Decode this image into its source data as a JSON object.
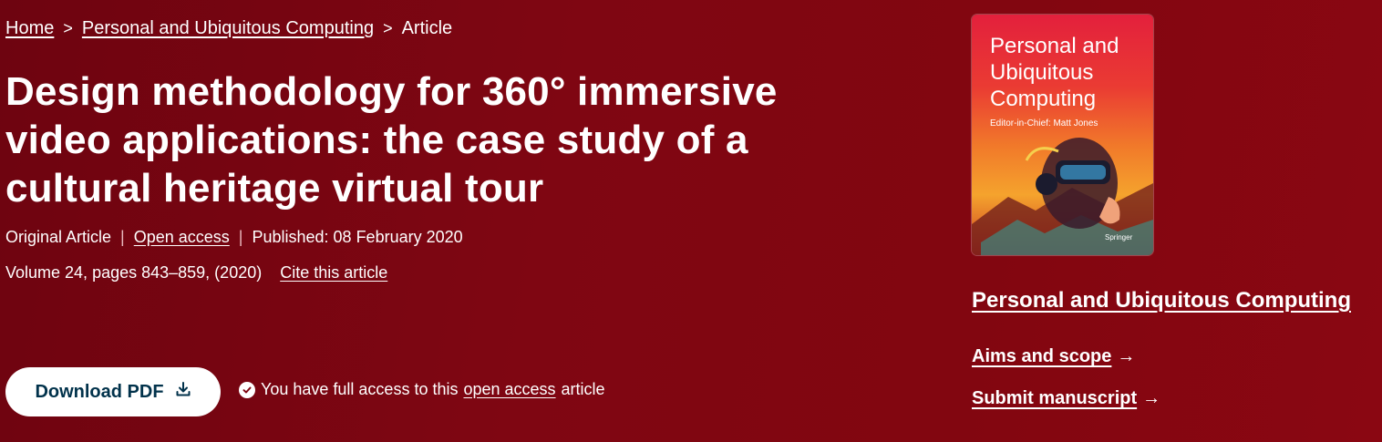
{
  "breadcrumb": {
    "items": [
      "Home",
      "Personal and Ubiquitous Computing",
      "Article"
    ],
    "separator": ">"
  },
  "article": {
    "title": "Design methodology for 360° immersive video applications: the case study of a cultural heritage virtual tour",
    "type": "Original Article",
    "access_label": "Open access",
    "published": "Published: 08 February 2020",
    "volume": "Volume 24, pages 843–859, (2020)",
    "cite_label": "Cite this article"
  },
  "actions": {
    "download_label": "Download PDF",
    "access_prefix": "You have full access to this",
    "access_link": "open access",
    "access_suffix": "article"
  },
  "journal": {
    "cover_title": "Personal and Ubiquitous Computing",
    "cover_editor": "Editor-in-Chief: Matt Jones",
    "cover_publisher": "Springer",
    "name": "Personal and Ubiquitous Computing",
    "aims_label": "Aims and scope",
    "submit_label": "Submit manuscript",
    "arrow": "→"
  },
  "colors": {
    "background": "#7f0612",
    "button_text": "#01324b",
    "text": "#ffffff"
  }
}
